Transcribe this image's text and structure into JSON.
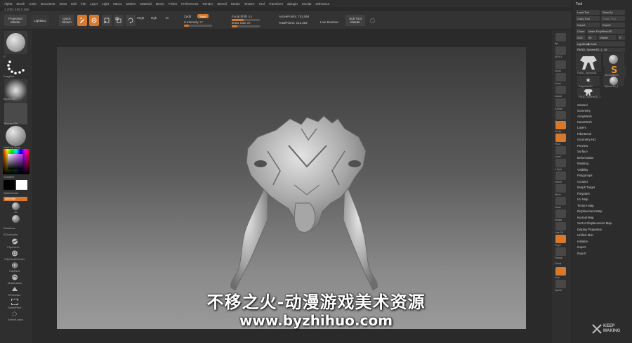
{
  "menu": [
    "Alpha",
    "Brush",
    "Color",
    "Document",
    "Draw",
    "Edit",
    "File",
    "Layer",
    "Light",
    "Macro",
    "Marker",
    "Material",
    "Movie",
    "Picker",
    "Preferences",
    "Render",
    "Stencil",
    "Stroke",
    "Texture",
    "Tool",
    "Transform",
    "Zplugin",
    "Zscript",
    "ZShortcut"
  ],
  "version": "2.2052.456.0.398",
  "toolbar": {
    "projection_master": "Projection Master",
    "lightbox": "LightBox",
    "quick_sketch": "Quick Sketch",
    "mode_buttons": [
      "Edit",
      "Draw",
      "Move",
      "Scale",
      "Rotate"
    ],
    "mrgb": "Mrgb",
    "rgb": "Rgb",
    "m": "M",
    "zadd": "Zadd",
    "zsub": "Zsub",
    "z_intensity_label": "Z Intensity",
    "z_intensity_value": "17",
    "focal_shift_label": "Focal Shift",
    "focal_shift_value": "-14",
    "draw_size_label": "Draw Size",
    "draw_size_value": "22",
    "active_points": "ActivePoints: 743,064",
    "total_points": "TotalPoints: 213,362",
    "live_boolean": "Live Boolean",
    "sub_tool_master": "Sub Tool Master"
  },
  "left_shelf": {
    "captions": [
      "Standard",
      "DragDot",
      "Alpha Off",
      "Texture Off",
      "MatCap Gray",
      "Gradient",
      "SwitchColor",
      "Alternate",
      "Shadows",
      "AOcclusion",
      "ClipCurve",
      "ClipCircleCenter",
      "ClipRect",
      "MaskLasso",
      "TrimLasso",
      "SelectRect",
      "SelectLasso"
    ],
    "number": "10"
  },
  "right_shelf": {
    "captions": [
      "Bpr",
      "SPix 3",
      "Scroll",
      "Zoom",
      "Actual",
      "AAHalf",
      "Dynamic",
      "Persp",
      "Floor",
      "Local",
      "L.Sym",
      "Frame",
      "Move",
      "Scale",
      "Rotate",
      "Line Fill",
      "PolyF",
      "Transp",
      "Ghost",
      "Solo",
      "Xpose"
    ]
  },
  "tool_panel": {
    "title": "Tool",
    "buttons": [
      "Load Tool",
      "Save As",
      "Copy Tool",
      "Paste Tool",
      "Import",
      "Export",
      "Clone",
      "Make PolyMesh3D",
      "GoZ",
      "All",
      "Visible",
      "R"
    ],
    "lightbox_tools": "Lightbox▶Tools",
    "current_tool": "PM3D_Sphere3D_1. 49",
    "thumbnails": [
      "PM3D_Sphere3D",
      "Sphere3D",
      "SimpleBrush",
      "PolyMesh3D",
      "Sphere3D_1",
      "PM3D_Sphere3D_1"
    ],
    "sections": [
      "Subtool",
      "Geometry",
      "ArrayMesh",
      "NanoMesh",
      "Layers",
      "FiberMesh",
      "Geometry HD",
      "Preview",
      "Surface",
      "Deformation",
      "Masking",
      "Visibility",
      "Polygroups",
      "Contact",
      "Morph Target",
      "Polypaint",
      "UV Map",
      "Texture Map",
      "Displacement Map",
      "Normal Map",
      "Vector Displacement Map",
      "Display Properties",
      "Unified Skin",
      "Initialize",
      "Import",
      "Export"
    ]
  },
  "watermark": {
    "chinese": "不移之火-动漫游戏美术资源",
    "url": "www.byzhihuo.com",
    "logo_line1": "KEEP",
    "logo_line2": "MAKING"
  },
  "colors": {
    "accent": "#d7792c",
    "panel": "#2c2c2c",
    "canvas_top": "#3a3a3a",
    "canvas_bottom": "#9a9a9a"
  }
}
